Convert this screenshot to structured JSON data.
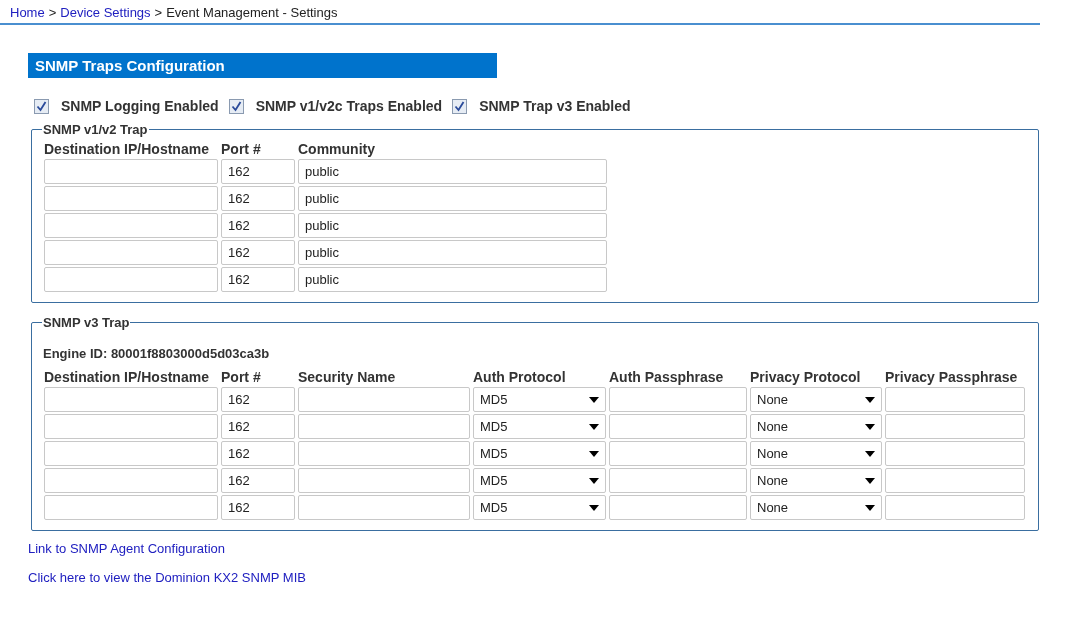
{
  "breadcrumb": [
    {
      "kind": "link",
      "text": "Home"
    },
    {
      "kind": "separator",
      "text": ">"
    },
    {
      "kind": "link",
      "text": "Device Settings"
    },
    {
      "kind": "separator",
      "text": ">"
    },
    {
      "kind": "current",
      "text": "Event Management - Settings"
    }
  ],
  "section_title": "SNMP Traps Configuration",
  "checkboxes": [
    {
      "label": "SNMP Logging Enabled",
      "checked": true
    },
    {
      "label": "SNMP v1/v2c Traps Enabled",
      "checked": true
    },
    {
      "label": "SNMP Trap v3 Enabled",
      "checked": true
    }
  ],
  "v1v2_trap": {
    "legend": "SNMP v1/v2 Trap",
    "columns": [
      "Destination IP/Hostname",
      "Port #",
      "Community"
    ],
    "rows": [
      {
        "port": "162",
        "community": "public"
      },
      {
        "port": "162",
        "community": "public"
      },
      {
        "port": "162",
        "community": "public"
      },
      {
        "port": "162",
        "community": "public"
      },
      {
        "port": "162",
        "community": "public"
      }
    ]
  },
  "v3_trap": {
    "legend": "SNMP v3 Trap",
    "engine_id": "Engine ID: 80001f8803000d5d03ca3b",
    "columns": [
      "Destination IP/Hostname",
      "Port #",
      "Security Name",
      "Auth Protocol",
      "Auth Passphrase",
      "Privacy Protocol",
      "Privacy Passphrase"
    ],
    "rows": [
      {
        "port": "162",
        "auth_protocol": "MD5",
        "privacy_protocol": "None"
      },
      {
        "port": "162",
        "auth_protocol": "MD5",
        "privacy_protocol": "None"
      },
      {
        "port": "162",
        "auth_protocol": "MD5",
        "privacy_protocol": "None"
      },
      {
        "port": "162",
        "auth_protocol": "MD5",
        "privacy_protocol": "None"
      },
      {
        "port": "162",
        "auth_protocol": "MD5",
        "privacy_protocol": "None"
      }
    ]
  },
  "links": [
    "Link to SNMP Agent Configuration",
    "Click here to view the Dominion KX2 SNMP MIB"
  ]
}
